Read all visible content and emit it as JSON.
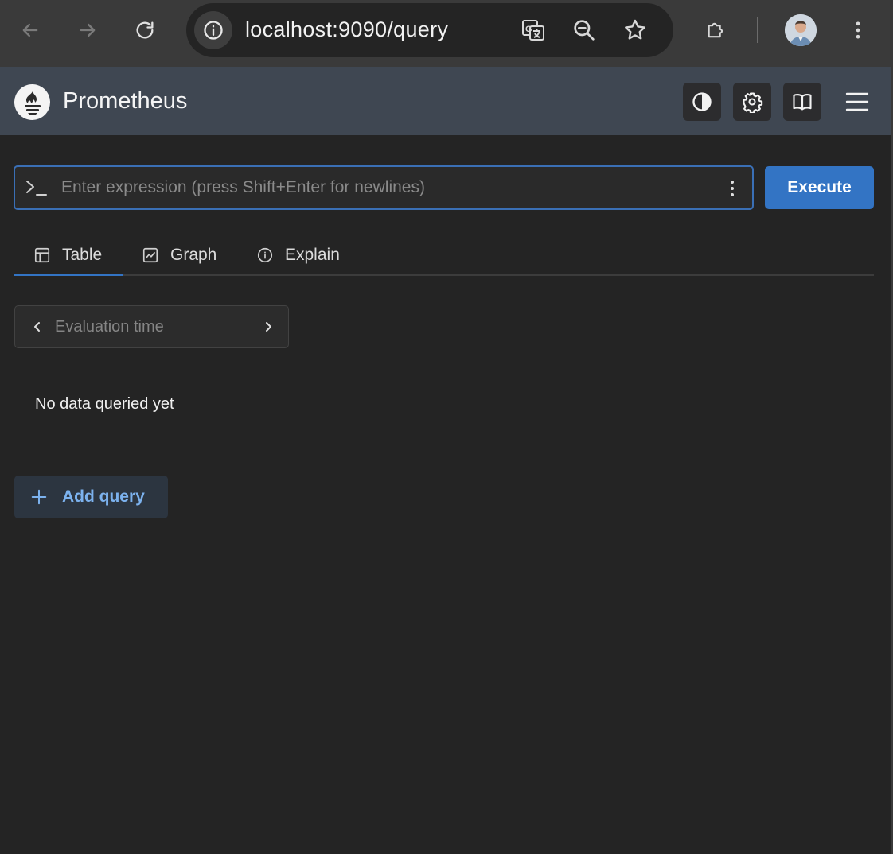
{
  "browser": {
    "url": "localhost:9090/query",
    "back_icon": "arrow-left-icon",
    "forward_icon": "arrow-right-icon",
    "reload_icon": "reload-icon",
    "translate_icon": "translate-icon",
    "zoom_icon": "zoom-out-icon",
    "bookmark_icon": "star-icon",
    "extensions_icon": "puzzle-icon",
    "menu_icon": "kebab-menu-icon"
  },
  "header": {
    "title": "Prometheus",
    "background": "#3f4752",
    "buttons": [
      "theme-toggle",
      "settings",
      "documentation",
      "menu"
    ]
  },
  "query": {
    "placeholder": "Enter expression (press Shift+Enter for newlines)",
    "value": "",
    "execute_label": "Execute",
    "accent": "#3374c4"
  },
  "tabs": [
    {
      "label": "Table",
      "icon": "table-icon",
      "active": true
    },
    {
      "label": "Graph",
      "icon": "chart-icon",
      "active": false
    },
    {
      "label": "Explain",
      "icon": "info-icon",
      "active": false
    }
  ],
  "eval_time": {
    "placeholder": "Evaluation time"
  },
  "result": {
    "empty_text": "No data queried yet"
  },
  "add_query": {
    "label": "Add query",
    "color": "#7cb2ee"
  }
}
